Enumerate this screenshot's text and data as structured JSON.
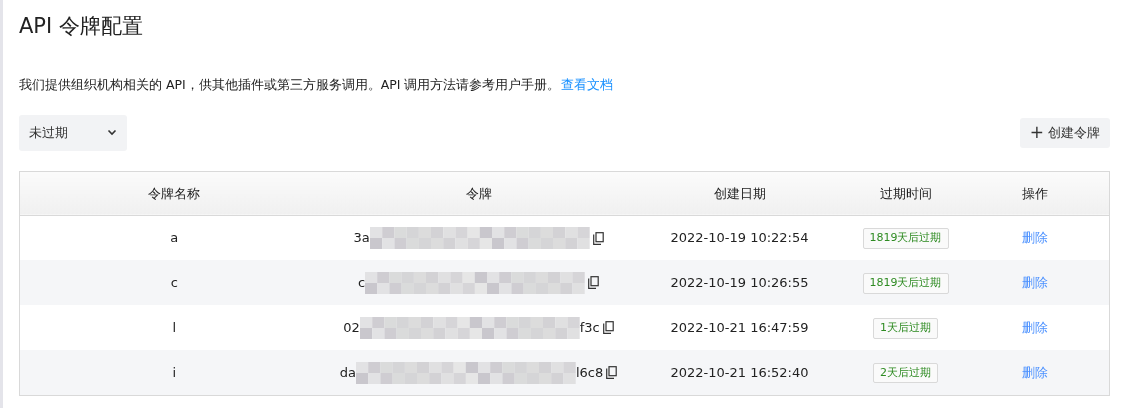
{
  "title": "API 令牌配置",
  "description": {
    "text": "我们提供组织机构相关的 API，供其他插件或第三方服务调用。API 调用方法请参考用户手册。",
    "link": "查看文档"
  },
  "filter": {
    "value": "未过期"
  },
  "create_button": {
    "icon": "+",
    "label": "创建令牌"
  },
  "table": {
    "columns": [
      "令牌名称",
      "令牌",
      "创建日期",
      "过期时间",
      "操作"
    ],
    "rows": [
      {
        "name": "a",
        "token_start": "3a",
        "token_end": "",
        "created": "2022-10-19 10:22:54",
        "expiry": "1819天后过期",
        "action": "删除"
      },
      {
        "name": "c",
        "token_start": "c",
        "token_end": "",
        "created": "2022-10-19 10:26:55",
        "expiry": "1819天后过期",
        "action": "删除"
      },
      {
        "name": "l",
        "token_start": "02",
        "token_end": "f3c",
        "created": "2022-10-21 16:47:59",
        "expiry": "1天后过期",
        "action": "删除"
      },
      {
        "name": "i",
        "token_start": "da",
        "token_end": "l6c8",
        "created": "2022-10-21 16:52:40",
        "expiry": "2天后过期",
        "action": "删除"
      }
    ]
  }
}
